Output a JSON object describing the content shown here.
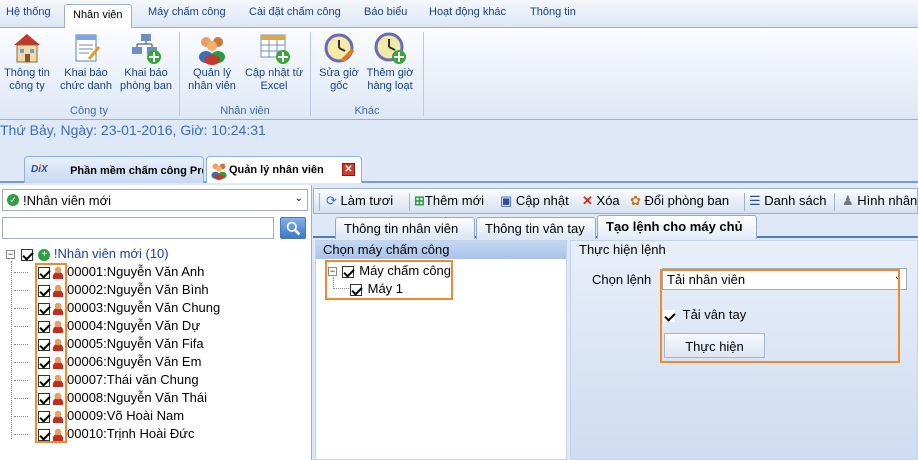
{
  "menu": {
    "tabs": [
      "Hệ thống",
      "Nhân viên",
      "Máy chấm công",
      "Cài đặt chấm công",
      "Báo biểu",
      "Hoạt động khác",
      "Thông tin"
    ]
  },
  "ribbon": {
    "groups": [
      {
        "label": "Công ty",
        "buttons": [
          {
            "line1": "Thông tin",
            "line2": "công ty",
            "icon": "building-icon"
          },
          {
            "line1": "Khai báo",
            "line2": "chức danh",
            "icon": "notepad-icon"
          },
          {
            "line1": "Khai báo",
            "line2": "phòng ban",
            "icon": "org-chart-add-icon"
          }
        ]
      },
      {
        "label": "Nhân viên",
        "buttons": [
          {
            "line1": "Quản lý",
            "line2": "nhân viên",
            "icon": "users-group-icon"
          },
          {
            "line1": "Cập nhật từ",
            "line2": "Excel",
            "icon": "excel-grid-add-icon"
          }
        ]
      },
      {
        "label": "Khác",
        "buttons": [
          {
            "line1": "Sửa giờ",
            "line2": "gốc",
            "icon": "clock-edit-icon"
          },
          {
            "line1": "Thêm giờ",
            "line2": "hàng loạt",
            "icon": "clock-add-icon"
          }
        ]
      }
    ]
  },
  "status_line": "Thứ Bảy, Ngày: 23-01-2016, Giờ: 10:24:31",
  "doc_tabs": [
    {
      "label": "Phần mềm chấm công Pro",
      "icon": "app-logo-icon"
    },
    {
      "label": "Quản lý nhân viên",
      "icon": "users-group-icon"
    }
  ],
  "left": {
    "combo_value": "!Nhân viên mới",
    "search_placeholder": "",
    "tree_root": "!Nhân viên mới (10)",
    "employees": [
      "00001:Nguyễn Văn Anh",
      "00002:Nguyễn Văn Bình",
      "00003:Nguyễn Văn Chung",
      "00004:Nguyễn Văn Dự",
      "00005:Nguyễn Văn Fifa",
      "00006:Nguyễn Văn Em",
      "00007:Thái văn Chung",
      "00008:Nguyễn Văn Thái",
      "00009:Võ Hoài Nam",
      "00010:Trịnh Hoài Đức"
    ]
  },
  "toolbar": {
    "refresh": "Làm tươi",
    "add": "Thêm mới",
    "update": "Cập nhật",
    "delete": "Xóa",
    "change_dept": "Đổi phòng ban",
    "list": "Danh sách",
    "photo": "Hình nhân"
  },
  "content_tabs": [
    "Thông tin nhân viên",
    "Thông tin vân tay",
    "Tạo lệnh cho máy chủ"
  ],
  "machine_group": {
    "title": "Chọn máy chấm công",
    "root": "Máy chấm công",
    "machines": [
      "Máy 1"
    ]
  },
  "command_group": {
    "title": "Thực hiện lệnh",
    "choose_label": "Chọn lệnh",
    "command_value": "Tải nhân viên",
    "checkbox_label": "Tải vân tay",
    "checkbox_checked": true,
    "execute_button": "Thực hiện"
  },
  "colors": {
    "highlight": "#f08a2c",
    "status_text": "#3b6db9",
    "ribbon_text": "#15428b"
  }
}
